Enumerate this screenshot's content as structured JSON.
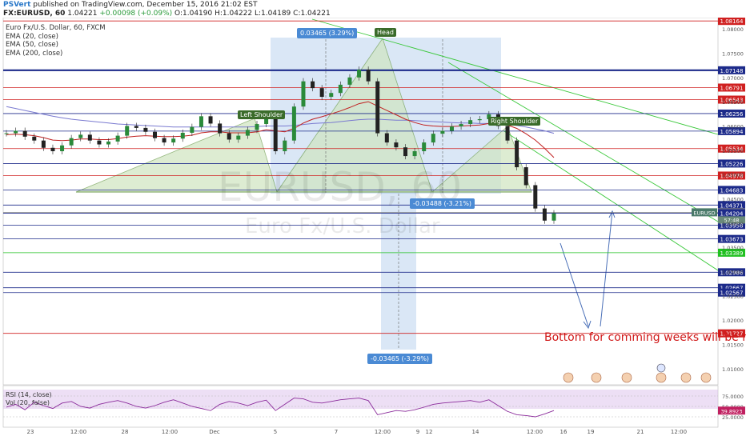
{
  "header": {
    "brand": "PSVert",
    "published": "published on TradingView.com, December 15, 2016 21:02 EST",
    "symbol": "FX:EURUSD, 60",
    "last": "1.04221",
    "change": "+0.00098 (+0.09%)",
    "open": "O:1.04190",
    "high": "H:1.04222",
    "low": "L:1.04189",
    "close": "C:1.04221"
  },
  "legend": {
    "title": "Euro Fx/U.S. Dollar, 60, FXCM",
    "ema20": "EMA (20, close)",
    "ema50": "EMA (50, close)",
    "ema200": "EMA (200, close)"
  },
  "rsi": {
    "label1": "RSI (14, close)",
    "label2": "Vol (20, false)"
  },
  "watermark": {
    "main": "EURUSD, 60",
    "sub": "Euro Fx/U.S. Dollar"
  },
  "patterns": {
    "head": "Head",
    "left_shoulder": "Left Shoulder",
    "right_shoulder": "Right Shoulder"
  },
  "measures": {
    "top": "0.03465 (3.29%)",
    "mid": "-0.03488 (-3.21%)",
    "bottom": "-0.03465 (-3.29%)"
  },
  "note": "Bottom for comming weeks will be h",
  "colors": {
    "up": "#2a9a3a",
    "red_level": "#d02020",
    "blue_level": "#1c2a8a",
    "green_level": "#20c020",
    "measure": "#4a8ad4",
    "pattern_fill": "#cfe5c0"
  },
  "chart_data": {
    "type": "line",
    "title": "Euro Fx/U.S. Dollar, 60, FXCM",
    "ylim": [
      1.007,
      1.082
    ],
    "yticks": [
      "1.08000",
      "1.07500",
      "1.07000",
      "1.06500",
      "1.06000",
      "1.05500",
      "1.05000",
      "1.04500",
      "1.04000",
      "1.03500",
      "1.03000",
      "1.02500",
      "1.02000",
      "1.01500",
      "1.01000"
    ],
    "xticks": [
      "23",
      "12:00",
      "28",
      "12:00",
      "Dec",
      "5",
      "7",
      "12:00",
      "9",
      "12",
      "14",
      "12:00",
      "16",
      "19",
      "21",
      "12:00"
    ],
    "levels": [
      {
        "label": "1.08164",
        "color": "red"
      },
      {
        "label": "1.07148",
        "color": "blue"
      },
      {
        "label": "1.06791",
        "color": "red"
      },
      {
        "label": "1.06543",
        "color": "red"
      },
      {
        "label": "1.06256",
        "color": "blue"
      },
      {
        "label": "1.05894",
        "color": "blue"
      },
      {
        "label": "1.05534",
        "color": "red"
      },
      {
        "label": "1.05226",
        "color": "blue"
      },
      {
        "label": "1.04978",
        "color": "red"
      },
      {
        "label": "1.04683",
        "color": "blue"
      },
      {
        "label": "1.04371",
        "color": "blue"
      },
      {
        "label": "1.04221",
        "color": "grey"
      },
      {
        "label": "1.04204",
        "color": "blue"
      },
      {
        "label": "1.03958",
        "color": "blue"
      },
      {
        "label": "1.03673",
        "color": "blue"
      },
      {
        "label": "1.03389",
        "color": "green"
      },
      {
        "label": "1.02986",
        "color": "blue"
      },
      {
        "label": "1.02667",
        "color": "blue"
      },
      {
        "label": "1.02567",
        "color": "blue"
      },
      {
        "label": "1.01727",
        "color": "red"
      }
    ],
    "price_tag": "EURUSD",
    "time_tag": "57:48",
    "rsi_ticks": [
      "75.0000",
      "50.0000",
      "25.0000"
    ],
    "rsi_value": "39.8923",
    "price_series": [
      1.0585,
      1.059,
      1.0578,
      1.057,
      1.0555,
      1.0548,
      1.056,
      1.0575,
      1.0582,
      1.057,
      1.0562,
      1.0568,
      1.058,
      1.06,
      1.0596,
      1.0588,
      1.0575,
      1.0566,
      1.0574,
      1.0586,
      1.0598,
      1.062,
      1.0605,
      1.0585,
      1.0572,
      1.058,
      1.0592,
      1.0604,
      1.0622,
      1.0548,
      1.057,
      1.064,
      1.0692,
      1.0678,
      1.066,
      1.0668,
      1.0685,
      1.07,
      1.0716,
      1.0692,
      1.0585,
      1.0566,
      1.0556,
      1.0538,
      1.0548,
      1.0566,
      1.0584,
      1.059,
      1.0599,
      1.0604,
      1.0612,
      1.0614,
      1.0624,
      1.06,
      1.057,
      1.0515,
      1.0478,
      1.043,
      1.0405,
      1.042
    ],
    "ema20": [
      1.0582,
      1.0583,
      1.0582,
      1.058,
      1.0576,
      1.0571,
      1.057,
      1.0571,
      1.0573,
      1.0573,
      1.0572,
      1.0572,
      1.0574,
      1.0577,
      1.0579,
      1.058,
      1.0579,
      1.0578,
      1.0578,
      1.0579,
      1.0581,
      1.0586,
      1.0588,
      1.0588,
      1.0586,
      1.0586,
      1.0586,
      1.0588,
      1.0592,
      1.059,
      1.0588,
      1.0595,
      1.0606,
      1.0614,
      1.0619,
      1.0625,
      1.0631,
      1.0638,
      1.0646,
      1.065,
      1.0641,
      1.0632,
      1.0623,
      1.0614,
      1.0607,
      1.0602,
      1.06,
      1.0599,
      1.0599,
      1.06,
      1.0601,
      1.0602,
      1.0605,
      1.0605,
      1.0602,
      1.0595,
      1.0584,
      1.0571,
      1.0554,
      1.0535
    ],
    "ema200": [
      1.064,
      1.0636,
      1.0632,
      1.0628,
      1.0624,
      1.062,
      1.0617,
      1.0614,
      1.0612,
      1.061,
      1.0608,
      1.0606,
      1.0604,
      1.0603,
      1.0602,
      1.0601,
      1.06,
      1.0599,
      1.0598,
      1.0598,
      1.0598,
      1.0598,
      1.0598,
      1.0598,
      1.0598,
      1.0598,
      1.0598,
      1.0599,
      1.06,
      1.06,
      1.06,
      1.0601,
      1.0603,
      1.0605,
      1.0606,
      1.0607,
      1.0609,
      1.0611,
      1.0613,
      1.0614,
      1.0614,
      1.0613,
      1.0612,
      1.0612,
      1.0611,
      1.061,
      1.0609,
      1.0608,
      1.0607,
      1.0606,
      1.0606,
      1.0605,
      1.0605,
      1.0604,
      1.0603,
      1.0601,
      1.0598,
      1.0594,
      1.059,
      1.0585
    ],
    "rsi_series": [
      48,
      55,
      42,
      60,
      52,
      45,
      58,
      62,
      50,
      46,
      55,
      60,
      64,
      58,
      50,
      46,
      52,
      60,
      66,
      58,
      50,
      45,
      40,
      55,
      62,
      58,
      52,
      60,
      65,
      40,
      55,
      70,
      68,
      60,
      58,
      62,
      66,
      68,
      70,
      64,
      30,
      35,
      40,
      38,
      42,
      48,
      55,
      58,
      60,
      62,
      64,
      60,
      66,
      52,
      38,
      30,
      28,
      25,
      32,
      40
    ]
  }
}
